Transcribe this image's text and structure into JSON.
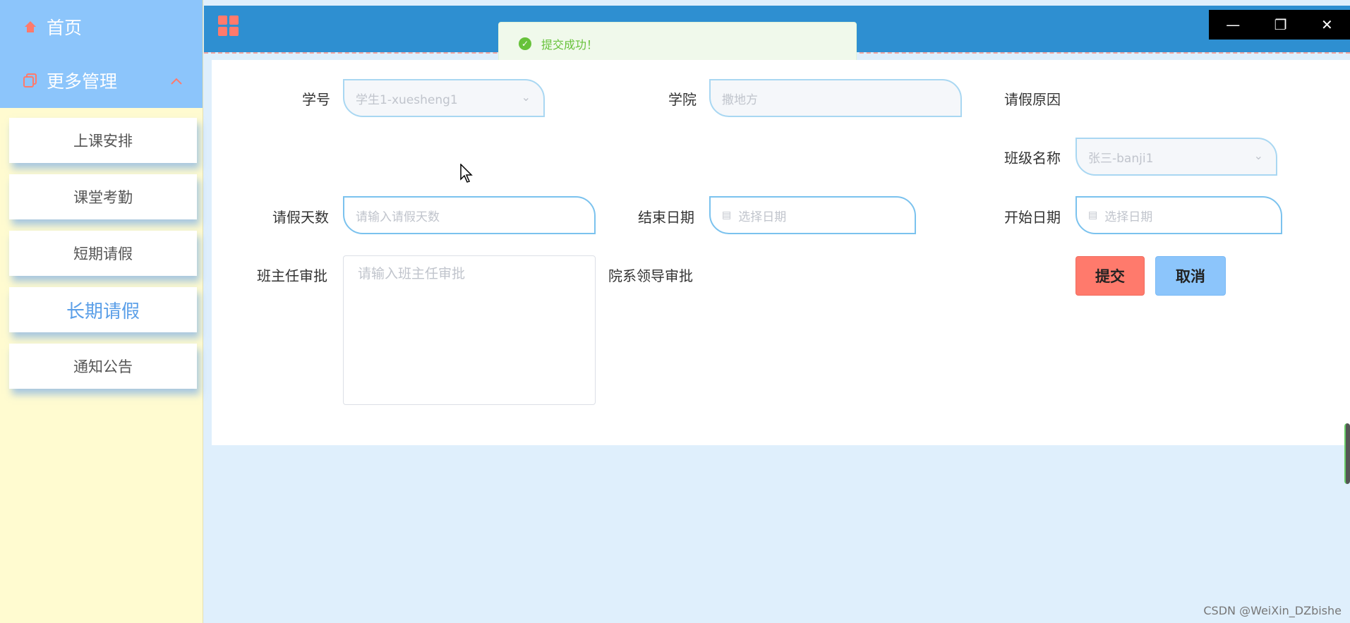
{
  "sidebar": {
    "home_label": "首页",
    "more_label": "更多管理",
    "items": [
      {
        "label": "上课安排"
      },
      {
        "label": "课堂考勤"
      },
      {
        "label": "短期请假"
      },
      {
        "label": "长期请假"
      },
      {
        "label": "通知公告"
      }
    ]
  },
  "toast": {
    "message": "提交成功！"
  },
  "form": {
    "student_id": {
      "label": "学号",
      "value": "学生1-xuesheng1"
    },
    "college": {
      "label": "学院",
      "value": "撒地方"
    },
    "reason": {
      "label": "请假原因"
    },
    "class_name": {
      "label": "班级名称",
      "value": "张三-banji1"
    },
    "days": {
      "label": "请假天数",
      "placeholder": "请输入请假天数"
    },
    "end_date": {
      "label": "结束日期",
      "placeholder": "选择日期"
    },
    "start_date": {
      "label": "开始日期",
      "placeholder": "选择日期"
    },
    "teacher_approval": {
      "label": "班主任审批",
      "placeholder": "请输入班主任审批"
    },
    "dept_approval": {
      "label": "院系领导审批"
    },
    "submit_label": "提交",
    "cancel_label": "取消"
  },
  "window": {
    "minimize": "—",
    "restore": "❐",
    "close": "✕"
  },
  "watermark": "CSDN @WeiXin_DZbishe",
  "colors": {
    "header": "#2e8fd1",
    "sidebar_top": "#8cc5fb",
    "sidebar_bg": "#fffbd0",
    "submit": "#ff7a6c",
    "cancel": "#8cc5fb",
    "success": "#67c23a"
  }
}
